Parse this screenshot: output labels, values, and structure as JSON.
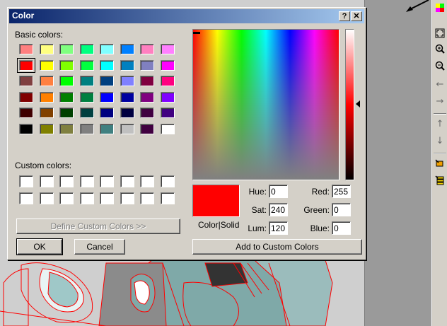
{
  "dialog": {
    "title": "Color",
    "help_label": "?",
    "close_label": "✕",
    "basic_colors_label": "Basic colors:",
    "custom_colors_label": "Custom colors:",
    "define_custom_label": "Define Custom Colors >>",
    "ok_label": "OK",
    "cancel_label": "Cancel",
    "color_solid_label": "Color|Solid",
    "add_custom_label": "Add to Custom Colors",
    "fields": {
      "hue_label": "Hue:",
      "hue_value": "0",
      "sat_label": "Sat:",
      "sat_value": "240",
      "lum_label": "Lum:",
      "lum_value": "120",
      "red_label": "Red:",
      "red_value": "255",
      "green_label": "Green:",
      "green_value": "0",
      "blue_label": "Blue:",
      "blue_value": "0"
    },
    "basic_colors": [
      [
        "#ff8080",
        "#ffff80",
        "#80ff80",
        "#00ff80",
        "#80ffff",
        "#0080ff",
        "#ff80c0",
        "#ff80ff"
      ],
      [
        "#ff0000",
        "#ffff00",
        "#80ff00",
        "#00ff40",
        "#00ffff",
        "#0080c0",
        "#8080c0",
        "#ff00ff"
      ],
      [
        "#804040",
        "#ff8040",
        "#00ff00",
        "#008080",
        "#004080",
        "#8080ff",
        "#800040",
        "#ff0080"
      ],
      [
        "#800000",
        "#ff8000",
        "#008000",
        "#008040",
        "#0000ff",
        "#0000a0",
        "#800080",
        "#8000ff"
      ],
      [
        "#400000",
        "#804000",
        "#004000",
        "#004040",
        "#000080",
        "#000040",
        "#400040",
        "#400080"
      ],
      [
        "#000000",
        "#808000",
        "#808040",
        "#808080",
        "#408080",
        "#c0c0c0",
        "#400040",
        "#ffffff"
      ]
    ],
    "selected_basic": [
      1,
      0
    ],
    "current_color": "#ff0000"
  },
  "toolbar": {
    "icons": [
      "color-cube-icon",
      "zoom-extents-icon",
      "zoom-in-icon",
      "zoom-out-icon",
      "pan-left-icon",
      "pan-right-icon",
      "pan-up-icon",
      "pan-down-icon",
      "layer-tool-icon",
      "layer-stack-icon"
    ]
  },
  "colors": {
    "title_start": "#0a246a",
    "title_end": "#a6caf0",
    "face": "#d4d0c8",
    "model_line": "#ff0000",
    "panel_gray": "#9a9a9a"
  }
}
